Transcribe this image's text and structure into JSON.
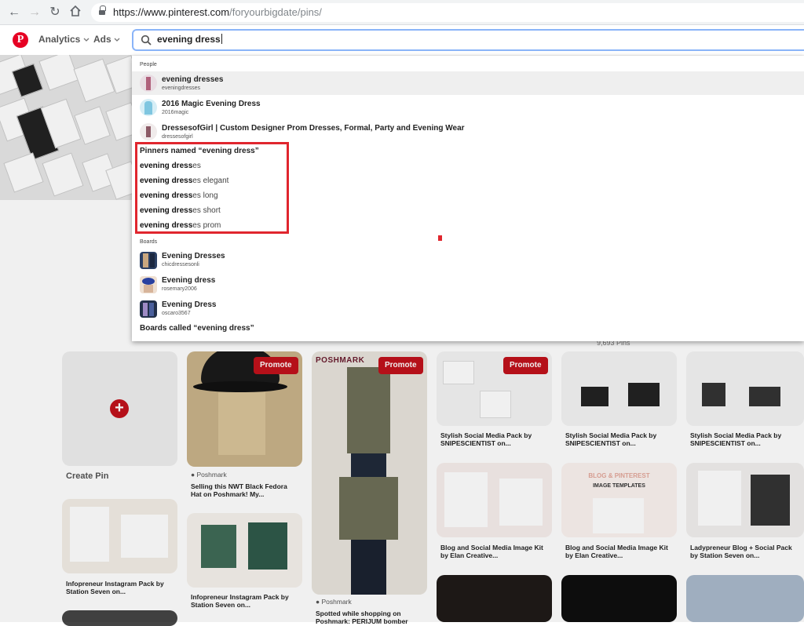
{
  "browser": {
    "url_host": "https://www.pinterest.com",
    "url_path": "/foryourbigdate/pins/"
  },
  "header": {
    "menu": [
      {
        "label": "Analytics",
        "chevron": "chevron-down-icon"
      },
      {
        "label": "Ads",
        "chevron": "chevron-down-icon"
      }
    ],
    "search_value": "evening dress"
  },
  "dropdown": {
    "people_heading": "People",
    "people": [
      {
        "name": "evening dresses",
        "handle": "eveningdresses"
      },
      {
        "name": "2016 Magic Evening Dress",
        "handle": "2016magic"
      },
      {
        "name": "DressesofGirl | Custom Designer Prom Dresses, Formal, Party and Evening Wear",
        "handle": "dressesofgirl"
      }
    ],
    "pinners_named": "Pinners named “evening dress”",
    "suggestions": [
      {
        "bold": "evening dress",
        "rest": "es"
      },
      {
        "bold": "evening dress",
        "rest": "es elegant"
      },
      {
        "bold": "evening dress",
        "rest": "es long"
      },
      {
        "bold": "evening dress",
        "rest": "es short"
      },
      {
        "bold": "evening dress",
        "rest": "es prom"
      }
    ],
    "boards_heading": "Boards",
    "boards": [
      {
        "name": "Evening Dresses",
        "handle": "chicdressesonli"
      },
      {
        "name": "Evening dress",
        "handle": "rosemary2006"
      },
      {
        "name": "Evening Dress",
        "handle": "oscaro3567"
      }
    ],
    "boards_called": "Boards called “evening dress”"
  },
  "grid": {
    "pin_count": "9,693 Pins",
    "create_pin": "Create Pin",
    "promote": "Promote",
    "poshmark": "POSHMARK",
    "source_poshmark": "Poshmark",
    "pins": [
      {
        "title_1": "Selling this NWT Black Fedora",
        "title_2": "Hat on Poshmark! My..."
      },
      {
        "title_1": "Spotted while shopping on",
        "title_2": "Poshmark: PERIJUM bomber"
      },
      {
        "title_1": "Stylish Social Media Pack by",
        "title_2": "SNIPESCIENTIST on..."
      },
      {
        "title_1": "Stylish Social Media Pack by",
        "title_2": "SNIPESCIENTIST on..."
      },
      {
        "title_1": "Stylish Social Media Pack by",
        "title_2": "SNIPESCIENTIST on..."
      },
      {
        "title_1": "Infopreneur Instagram Pack by",
        "title_2": "Station Seven on..."
      },
      {
        "title_1": "Infopreneur Instagram Pack by",
        "title_2": "Station Seven on..."
      },
      {
        "title_1": "Blog and Social Media Image Kit",
        "title_2": "by Elan Creative..."
      },
      {
        "title_1": "Blog and Social Media Image Kit",
        "title_2": "by Elan Creative..."
      },
      {
        "title_1": "Ladypreneur Blog + Social Pack",
        "title_2": "by Station Seven on..."
      }
    ],
    "blog_card_title": "BLOG & PINTEREST",
    "blog_card_sub": "IMAGE TEMPLATES"
  }
}
